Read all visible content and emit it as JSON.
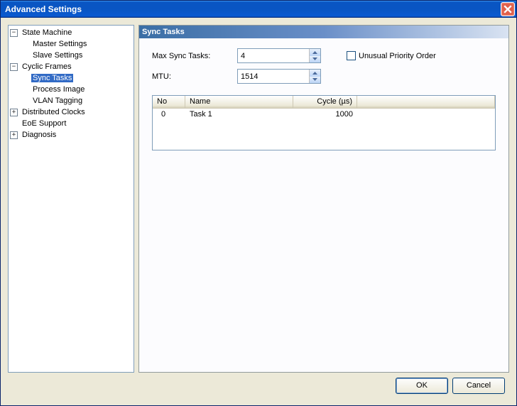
{
  "title": "Advanced Settings",
  "tree": {
    "state_machine": "State Machine",
    "master_settings": "Master Settings",
    "slave_settings": "Slave Settings",
    "cyclic_frames": "Cyclic Frames",
    "sync_tasks": "Sync Tasks",
    "process_image": "Process Image",
    "vlan_tagging": "VLAN Tagging",
    "distributed_clocks": "Distributed Clocks",
    "eoe_support": "EoE Support",
    "diagnosis": "Diagnosis",
    "minus": "−",
    "plus": "+"
  },
  "panel": {
    "header": "Sync Tasks",
    "max_sync_label": "Max Sync Tasks:",
    "max_sync_value": "4",
    "mtu_label": "MTU:",
    "mtu_value": "1514",
    "unusual_priority": "Unusual Priority Order",
    "table": {
      "no": "No",
      "name": "Name",
      "cycle": "Cycle (µs)",
      "row0_no": "0",
      "row0_name": "Task 1",
      "row0_cycle": "1000"
    }
  },
  "buttons": {
    "ok": "OK",
    "cancel": "Cancel"
  }
}
